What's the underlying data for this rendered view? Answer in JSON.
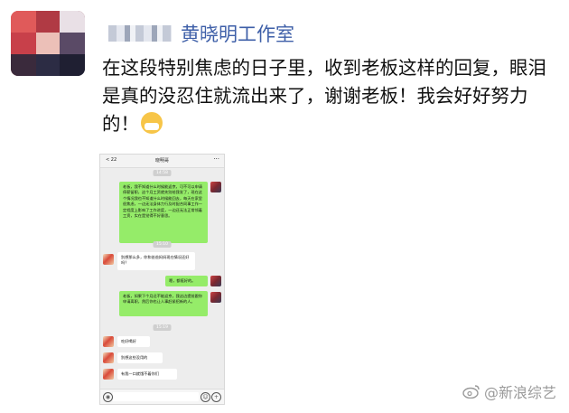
{
  "post": {
    "author": "黄晓明工作室",
    "text": "在这段特别焦虑的日子里，收到老板这样的回复，眼泪是真的没忍住就流出来了，谢谢老板！我会好好努力的！",
    "emoji": "mask-face-emoji"
  },
  "phone": {
    "back_label": "< 22",
    "title": "晓明哥",
    "more_label": "···",
    "messages": [
      {
        "type": "time",
        "text": "14:58"
      },
      {
        "type": "sent",
        "text": "老板，我不知道什么时候能返京，可不可以申请停薪留职，这个月工资就先别给我发了，现在这个情况我也不知道什么时候能回去，每天在家里很焦虑，一边无法身体力行及时配合同事工作一定程度上影响了工作进度，一边还无法正常领着工资，实在是觉得不好意思。"
      },
      {
        "type": "time",
        "text": "15:10"
      },
      {
        "type": "received",
        "text": "别想那么多，你和爸爸妈妈现在情况还好吗？"
      },
      {
        "type": "sent",
        "text": "嗯，都挺好的。"
      },
      {
        "type": "sent",
        "text": "老板，如果下个月还不能返京，我这边提前跟你申请离职，然后你也让人事赶紧招新的人。"
      },
      {
        "type": "time",
        "text": "15:19"
      },
      {
        "type": "received",
        "text": "吃好喝好"
      },
      {
        "type": "received",
        "text": "别想这些没用的"
      },
      {
        "type": "received",
        "text": "有我一口就饿不着你们"
      }
    ]
  },
  "watermark": {
    "text": "@新浪综艺"
  },
  "colors": {
    "author": "#3e5fa8",
    "sent_bubble": "#95ec69",
    "received_bubble": "#ffffff",
    "chat_bg": "#ededed"
  }
}
